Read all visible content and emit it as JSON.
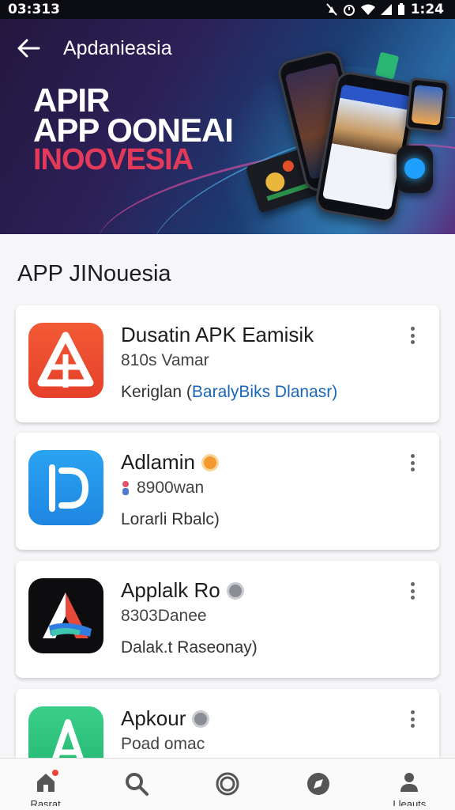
{
  "status_bar": {
    "time": "03:313",
    "clock": "1:24"
  },
  "header": {
    "title": "Apdanieasia",
    "headline_1": "APIR",
    "headline_2": "APP OONEAI",
    "headline_3": "INOOVESIA"
  },
  "section": {
    "title": "APP JINouesia"
  },
  "apps": [
    {
      "name": "Dusatin APK Eamisik",
      "sub": "810s Vamar",
      "desc_prefix": "Keriglan (",
      "desc_link": "BaralyBiks Dlanasr)",
      "icon": "triangle-logo-icon"
    },
    {
      "name": "Adlamin",
      "sub": "8900wan",
      "desc": "Lorarli Rbalc)",
      "icon": "d-logo-icon"
    },
    {
      "name": "Applalk Ro",
      "sub": "8303Danee",
      "desc": "Dalak.t Raseonay)",
      "icon": "a-logo-icon"
    },
    {
      "name": "Apkour",
      "sub": "Poad omac",
      "icon": "green-a-logo-icon"
    }
  ],
  "bottom_nav": [
    {
      "label": "Rasrat",
      "icon": "home-icon"
    },
    {
      "label": "",
      "icon": "search-icon"
    },
    {
      "label": "",
      "icon": "circle-icon"
    },
    {
      "label": "",
      "icon": "compass-icon"
    },
    {
      "label": "Lleauts",
      "icon": "profile-icon"
    }
  ],
  "colors": {
    "accent_red": "#e33a5a",
    "link_blue": "#1a66b8",
    "badge_orange": "#f29a2e"
  }
}
